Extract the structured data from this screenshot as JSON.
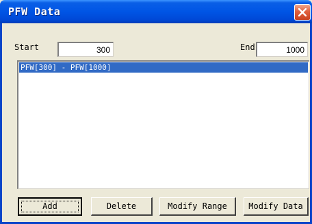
{
  "window": {
    "title": "PFW Data",
    "close_icon": "close-x-icon",
    "titlebar_color": "#0055e5"
  },
  "range": {
    "start_label": "Start",
    "start_value": "300",
    "end_label": "End",
    "end_value": "1000"
  },
  "list": {
    "items": [
      {
        "label": "PFW[300] - PFW[1000]",
        "selected": true
      }
    ],
    "selection_color": "#316ac5"
  },
  "buttons": {
    "add": "Add",
    "delete": "Delete",
    "modify_range": "Modify Range",
    "modify_data": "Modify Data"
  }
}
